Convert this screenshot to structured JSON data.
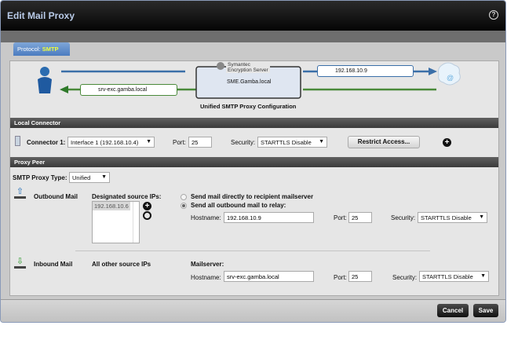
{
  "window": {
    "title": "Edit Mail Proxy",
    "help_icon": "?"
  },
  "protocol": {
    "label": "Protocol:",
    "value": "SMTP"
  },
  "diagram": {
    "server_brand": "Symantec",
    "server_product": "Encryption Server",
    "server_name": "SME.Gamba.local",
    "relay_host": "192.168.10.9",
    "mailserver_host": "srv-exc.gamba.local",
    "caption": "Unified SMTP Proxy Configuration",
    "internet_icon": "@"
  },
  "local_connector": {
    "header": "Local Connector",
    "connector_label": "Connector 1:",
    "interface": "Interface 1 (192.168.10.4)",
    "port_label": "Port:",
    "port": "25",
    "security_label": "Security:",
    "security": "STARTTLS Disable",
    "restrict_button": "Restrict Access...",
    "add_icon": "+"
  },
  "proxy_peer": {
    "header": "Proxy Peer",
    "type_label": "SMTP Proxy Type:",
    "type": "Unified",
    "outbound": {
      "label": "Outbound Mail",
      "designated_label": "Designated source IPs:",
      "source_ips": [
        "192.168.10.6"
      ],
      "option_direct": "Send mail directly to recipient mailserver",
      "option_relay": "Send all outbound mail to relay:",
      "selected": "relay",
      "hostname_label": "Hostname:",
      "hostname": "192.168.10.9",
      "port_label": "Port:",
      "port": "25",
      "security_label": "Security:",
      "security": "STARTTLS Disable"
    },
    "inbound": {
      "label": "Inbound Mail",
      "sources": "All other source IPs",
      "mailserver_label": "Mailserver:",
      "hostname_label": "Hostname:",
      "hostname": "srv-exc.gamba.local",
      "port_label": "Port:",
      "port": "25",
      "security_label": "Security:",
      "security": "STARTTLS Disable"
    }
  },
  "footer": {
    "cancel": "Cancel",
    "save": "Save"
  }
}
